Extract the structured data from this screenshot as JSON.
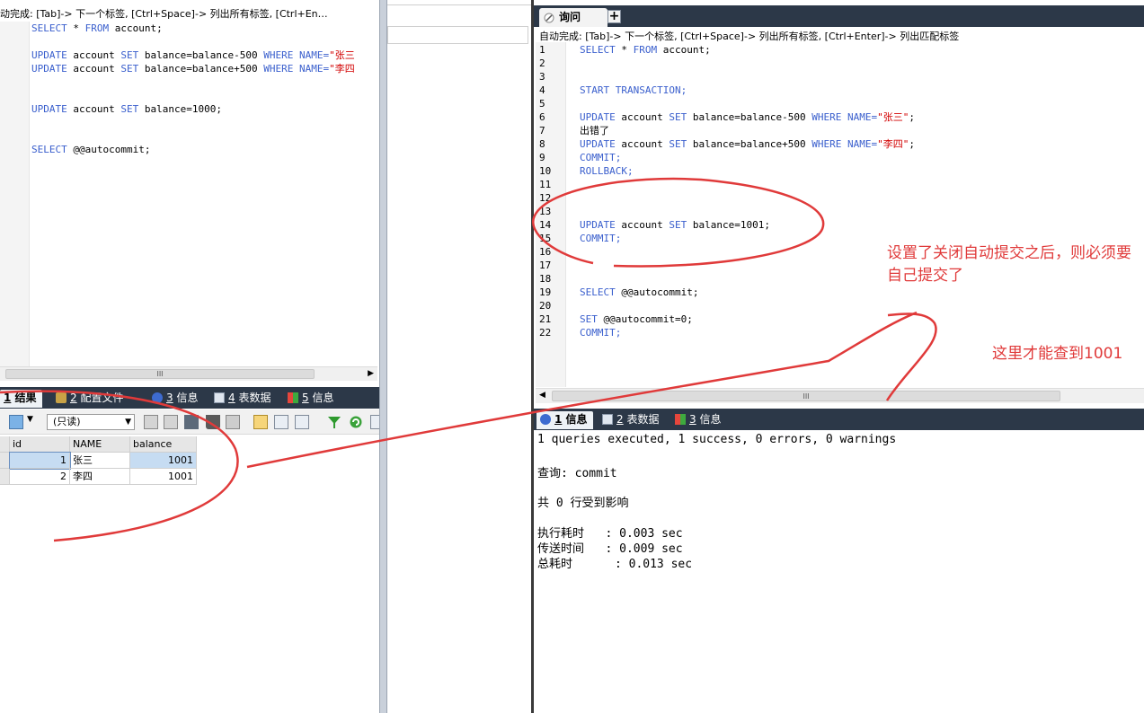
{
  "left": {
    "hint": "动完成: [Tab]-> 下一个标签, [Ctrl+Space]-> 列出所有标签, [Ctrl+En…",
    "code": [
      [
        {
          "t": "SELECT ",
          "c": "kw"
        },
        {
          "t": "* ",
          "c": ""
        },
        {
          "t": "FROM ",
          "c": "kw"
        },
        {
          "t": "account;",
          "c": ""
        }
      ],
      [],
      [
        {
          "t": "UPDATE ",
          "c": "kw"
        },
        {
          "t": "account ",
          "c": ""
        },
        {
          "t": "SET ",
          "c": "kw"
        },
        {
          "t": "balance=balance-500 ",
          "c": ""
        },
        {
          "t": "WHERE ",
          "c": "kw"
        },
        {
          "t": "NAME=",
          "c": "kw"
        },
        {
          "t": "\"张三",
          "c": "str"
        }
      ],
      [
        {
          "t": "UPDATE ",
          "c": "kw"
        },
        {
          "t": "account ",
          "c": ""
        },
        {
          "t": "SET ",
          "c": "kw"
        },
        {
          "t": "balance=balance+500 ",
          "c": ""
        },
        {
          "t": "WHERE ",
          "c": "kw"
        },
        {
          "t": "NAME=",
          "c": "kw"
        },
        {
          "t": "\"李四",
          "c": "str"
        }
      ],
      [],
      [],
      [
        {
          "t": "UPDATE ",
          "c": "kw"
        },
        {
          "t": "account ",
          "c": ""
        },
        {
          "t": "SET ",
          "c": "kw"
        },
        {
          "t": "balance=1000;",
          "c": ""
        }
      ],
      [],
      [],
      [
        {
          "t": "SELECT ",
          "c": "kw"
        },
        {
          "t": "@@autocommit;",
          "c": ""
        }
      ]
    ],
    "tabs": [
      {
        "label": "1 结果",
        "num": "1",
        "rest": " 结果"
      },
      {
        "label": "2 配置文件",
        "num": "2",
        "rest": " 配置文件"
      },
      {
        "label": "3 信息",
        "num": "3",
        "rest": " 信息"
      },
      {
        "label": "4 表数据",
        "num": "4",
        "rest": " 表数据"
      },
      {
        "label": "5 信息",
        "num": "5",
        "rest": " 信息"
      }
    ],
    "readonly": "(只读)",
    "grid": {
      "columns": [
        "id",
        "NAME",
        "balance"
      ],
      "rows": [
        [
          "1",
          "张三",
          "1001"
        ],
        [
          "2",
          "李四",
          "1001"
        ]
      ]
    }
  },
  "right": {
    "tab_label": "询问",
    "hint": "自动完成: [Tab]-> 下一个标签, [Ctrl+Space]-> 列出所有标签, [Ctrl+Enter]-> 列出匹配标签",
    "line_numbers": [
      "1",
      "2",
      "3",
      "4",
      "5",
      "6",
      "7",
      "8",
      "9",
      "10",
      "11",
      "12",
      "13",
      "14",
      "15",
      "16",
      "17",
      "18",
      "19",
      "20",
      "21",
      "22"
    ],
    "code": [
      [
        {
          "t": "SELECT ",
          "c": "kw"
        },
        {
          "t": "* ",
          "c": ""
        },
        {
          "t": "FROM ",
          "c": "kw"
        },
        {
          "t": "account;",
          "c": ""
        }
      ],
      [],
      [],
      [
        {
          "t": "START TRANSACTION;",
          "c": "kw"
        }
      ],
      [],
      [
        {
          "t": "UPDATE ",
          "c": "kw"
        },
        {
          "t": "account ",
          "c": ""
        },
        {
          "t": "SET ",
          "c": "kw"
        },
        {
          "t": "balance=balance-500 ",
          "c": ""
        },
        {
          "t": "WHERE ",
          "c": "kw"
        },
        {
          "t": "NAME=",
          "c": "kw"
        },
        {
          "t": "\"张三\"",
          "c": "str"
        },
        {
          "t": ";",
          "c": ""
        }
      ],
      [
        {
          "t": "出错了",
          "c": ""
        }
      ],
      [
        {
          "t": "UPDATE ",
          "c": "kw"
        },
        {
          "t": "account ",
          "c": ""
        },
        {
          "t": "SET ",
          "c": "kw"
        },
        {
          "t": "balance=balance+500 ",
          "c": ""
        },
        {
          "t": "WHERE ",
          "c": "kw"
        },
        {
          "t": "NAME=",
          "c": "kw"
        },
        {
          "t": "\"李四\"",
          "c": "str"
        },
        {
          "t": ";",
          "c": ""
        }
      ],
      [
        {
          "t": "COMMIT;",
          "c": "kw"
        }
      ],
      [
        {
          "t": "ROLLBACK;",
          "c": "kw"
        }
      ],
      [],
      [],
      [],
      [
        {
          "t": "UPDATE ",
          "c": "kw"
        },
        {
          "t": "account ",
          "c": ""
        },
        {
          "t": "SET ",
          "c": "kw"
        },
        {
          "t": "balance=1001;",
          "c": ""
        }
      ],
      [
        {
          "t": "COMMIT;",
          "c": "kw"
        }
      ],
      [],
      [],
      [],
      [
        {
          "t": "SELECT ",
          "c": "kw"
        },
        {
          "t": "@@autocommit;",
          "c": ""
        }
      ],
      [],
      [
        {
          "t": "SET ",
          "c": "kw"
        },
        {
          "t": "@@autocommit=0;",
          "c": ""
        }
      ],
      [
        {
          "t": "COMMIT;",
          "c": "kw"
        }
      ]
    ],
    "tabs": [
      {
        "label": "1 信息",
        "num": "1",
        "rest": " 信息"
      },
      {
        "label": "2 表数据",
        "num": "2",
        "rest": " 表数据"
      },
      {
        "label": "3 信息",
        "num": "3",
        "rest": " 信息"
      }
    ],
    "output": {
      "summary": "1 queries executed, 1 success, 0 errors, 0 warnings",
      "query": "查询: commit",
      "affected": "共 0 行受到影响",
      "exec_time": "执行耗时   : 0.003 sec",
      "transfer_time": "传送时间   : 0.009 sec",
      "total_time": "总耗时      : 0.013 sec"
    }
  },
  "annotations": {
    "note1": "设置了关闭自动提交之后，则必须要自己提交了",
    "note2": "这里才能查到1001",
    "color": "#e03a3a"
  },
  "colors": {
    "keyword": "#3a5fcd",
    "string": "#d20000",
    "tabbar": "#2c3848"
  }
}
